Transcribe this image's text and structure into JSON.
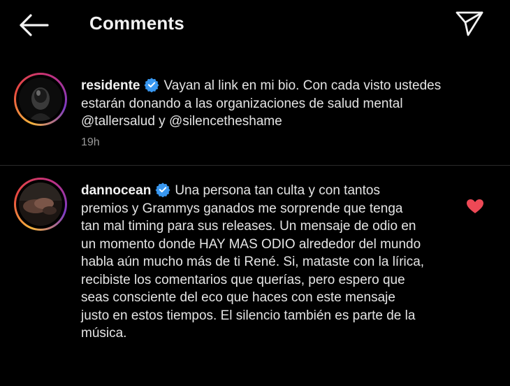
{
  "header": {
    "title": "Comments",
    "back_icon": "arrow-left-icon",
    "send_icon": "paper-plane-icon"
  },
  "comments": [
    {
      "username": "residente",
      "verified": true,
      "lines": [
        "Vayan al link en mi bio. Con cada visto ustedes",
        "estarán donando a las organizaciones de salud mental",
        "@tallersalud y @silencetheshame"
      ],
      "time": "19h"
    },
    {
      "username": "dannocean",
      "verified": true,
      "liked": true,
      "lines": [
        "Una persona tan culta y con tantos",
        "premios y Grammys ganados me sorprende que tenga",
        "tan mal timing para sus releases. Un mensaje de odio en",
        "un momento donde HAY MAS ODIO alrededor del mundo",
        "habla aún mucho más de ti René. Si, mataste con la lírica,",
        "recibiste los comentarios que querías, pero espero que",
        "seas consciente del eco que haces con este mensaje",
        "justo en estos tiempos. El silencio también es parte de la",
        "música."
      ]
    }
  ],
  "colors": {
    "background": "#000000",
    "text": "#e4e4e4",
    "muted": "#9a9a9a",
    "verified": "#3897f0",
    "like": "#ed4956"
  }
}
